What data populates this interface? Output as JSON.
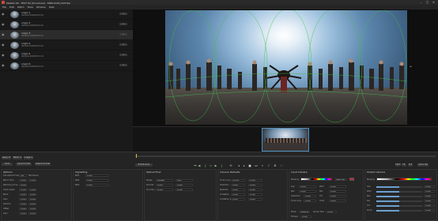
{
  "app": {
    "title": "Mistika VR - TEST 00 [Unnamed] - TRIPLICAM_SUIT.fps",
    "menu": [
      "File",
      "Edit",
      "Stitch",
      "Tools",
      "Window",
      "Help"
    ],
    "window_controls": [
      "–",
      "□",
      "✕"
    ]
  },
  "clips": [
    {
      "name": "origin 1",
      "sub": "000000:000000f:0:0:0",
      "badge": "1"
    },
    {
      "name": "origin 2",
      "sub": "000000:000000f:0:0:0",
      "badge": "1"
    },
    {
      "name": "origin 3",
      "sub": "000000:000000f:0:0:0",
      "badge": "1"
    },
    {
      "name": "origin 4",
      "sub": "000000:000000f:0:0:0",
      "badge": "1"
    },
    {
      "name": "origin 5",
      "sub": "000000:000000f:0:0:0",
      "badge": "1"
    },
    {
      "name": "origin 6",
      "sub": "000000:000000f:0:0:0",
      "badge": "1"
    }
  ],
  "icons": {
    "eye": "eye-icon",
    "play": "play-icon",
    "stop": "stop-icon"
  },
  "controls": {
    "left_buttons_row1": [
      "Apply To",
      "Match In",
      "Image In"
    ],
    "left_buttons_row2": [
      "Undo",
      "Input Format",
      "Output Format"
    ],
    "edit_mode": "Edit Normal",
    "right_buttons": [
      "100%",
      "Fit",
      "Full",
      "Quick Set"
    ],
    "timecode": "00:00:00:00"
  },
  "panels": {
    "options": {
      "title": "Options",
      "rows": [
        {
          "label": "Use Optical Flow",
          "value": "Yes",
          "extra": "Mid Stereo"
        },
        {
          "label": "Blend Time",
          "value": "0.000",
          "extra": "1.000"
        },
        {
          "label": "Stitching Curve",
          "value": "0.000",
          "extra": ""
        },
        {
          "label": "Input Levels",
          "value": "0.000",
          "extra": "1.000"
        },
        {
          "label": "Black",
          "value": "0.000",
          "extra": "0.000"
        },
        {
          "label": "Auto",
          "value": "0.000",
          "extra": "0.000"
        },
        {
          "label": "Gamma",
          "value": "0.000",
          "extra": "0.000"
        },
        {
          "label": "Offset",
          "value": "0.000",
          "extra": "0.000"
        },
        {
          "label": "Gain",
          "value": "0.000",
          "extra": "0.000"
        }
      ]
    },
    "vignetting": {
      "title": "Vignetting",
      "rows": [
        {
          "label": "Ref1",
          "value": "0.000"
        },
        {
          "label": "Ref2",
          "value": "0.000"
        },
        {
          "label": "Ref3",
          "value": "0.000"
        }
      ]
    },
    "optical_flow": {
      "title": "Optical Flow",
      "rows": [
        {
          "label": "Range",
          "value": "Largest",
          "extra": "Low"
        },
        {
          "label": "Smooth",
          "value": "0.000",
          "extra": "0.000"
        },
        {
          "label": "Accuracy",
          "value": "0.000",
          "extra": "0.000"
        }
      ]
    },
    "camera_defaults": {
      "title": "Camera Defaults",
      "rows": [
        {
          "label": "Focal Long.",
          "value": "19.885",
          "extra": "0.000"
        },
        {
          "label": "Distortion",
          "value": "0.000",
          "extra": "0.000"
        },
        {
          "label": "Spherize",
          "value": "0.000",
          "extra": "0.000"
        },
        {
          "label": "Limitation",
          "value": "0.000",
          "extra": "0.000"
        },
        {
          "label": "Limitation 2",
          "value": "0.000",
          "extra": "0.000"
        }
      ]
    },
    "input_camera": {
      "title": "Input Camera",
      "masking_label": "Masking",
      "masking_value": "Mask Left",
      "fields": [
        {
          "label": "Yaw",
          "value": "0.000",
          "extra": "Pitch",
          "extra_value": "0.000"
        },
        {
          "label": "Roll",
          "value": "0.000",
          "extra": "Pan",
          "extra_value": "0.000"
        },
        {
          "label": "Distortion",
          "value": "0.000",
          "extra": "Tilt",
          "extra_value": "0.000"
        },
        {
          "label": "Focal Long.",
          "value": "0.000",
          "extra": "Limit",
          "extra_value": "0.000"
        }
      ],
      "bottom": [
        {
          "label": "Mode",
          "value": "Defaults"
        },
        {
          "label": "Sensor Size",
          "value": "0.000"
        },
        {
          "label": "Fisheye",
          "value": "0.000"
        }
      ]
    },
    "output_camera": {
      "title": "Output Camera",
      "masking_label": "Masking",
      "fields": [
        {
          "label": "Yaw",
          "value": "0.000"
        },
        {
          "label": "Pitch",
          "value": "0.000"
        },
        {
          "label": "Roll",
          "value": "0.000"
        },
        {
          "label": "Pan",
          "value": "0.000"
        },
        {
          "label": "Tilt",
          "value": "0.000"
        },
        {
          "label": "Zoom",
          "value": "0.000"
        }
      ]
    }
  },
  "colors": {
    "accent": "#4f90c0",
    "timeline_marker": "#d8c23a",
    "play_green": "#9fd38a"
  }
}
